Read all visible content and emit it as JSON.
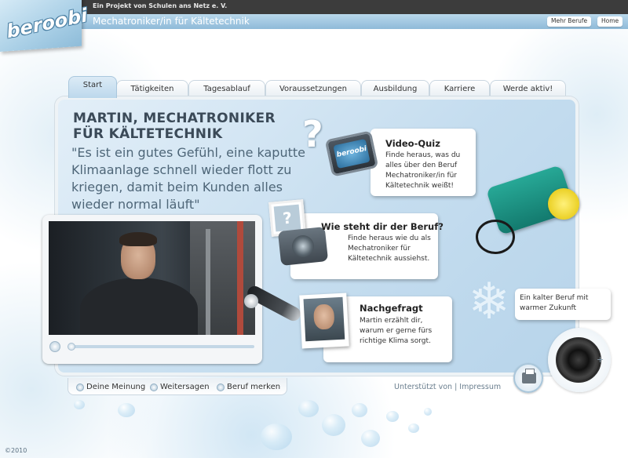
{
  "header": {
    "logo_text": "beroobi",
    "project_text": "Ein Projekt von Schulen ans Netz e. V.",
    "page_title": "Mechatroniker/in für Kältetechnik",
    "buttons": {
      "more_jobs": "Mehr Berufe",
      "home": "Home"
    }
  },
  "tabs": [
    {
      "label": "Start",
      "active": true
    },
    {
      "label": "Tätigkeiten",
      "active": false
    },
    {
      "label": "Tagesablauf",
      "active": false
    },
    {
      "label": "Voraussetzungen",
      "active": false
    },
    {
      "label": "Ausbildung",
      "active": false
    },
    {
      "label": "Karriere",
      "active": false
    },
    {
      "label": "Werde aktiv!",
      "active": false
    }
  ],
  "main": {
    "heading_line1": "MARTIN, MECHATRONIKER",
    "heading_line2": "FÜR KÄLTETECHNIK",
    "quote": "\"Es ist ein gutes Gefühl, eine kaputte Klimaanlage schnell wieder flott zu kriegen, damit beim Kunden alles wieder normal läuft\""
  },
  "cards": {
    "video_quiz": {
      "title": "Video-Quiz",
      "text": "Finde heraus, was du alles über den Beruf Mechatroniker/in für Kältetechnik weißt!",
      "icon_text": "beroobi"
    },
    "wie_steht": {
      "title": "Wie steht dir der Beruf?",
      "text": "Finde heraus wie du als Mechatroniker für Kältetechnik aussiehst."
    },
    "nachgefragt": {
      "title": "Nachgefragt",
      "text": "Martin erzählt dir, warum er gerne fürs richtige Klima sorgt."
    },
    "cold": {
      "text": "Ein kalter Beruf mit warmer Zukunft"
    }
  },
  "bottom": {
    "links": [
      "Deine Meinung",
      "Weitersagen",
      "Beruf merken"
    ],
    "footer": "Unterstützt von | Impressum",
    "copyright": "©2010"
  },
  "icons": {
    "question": "?",
    "photo": "?",
    "snowflake": "❄",
    "volume_plus": "+"
  },
  "colors": {
    "accent": "#8fbad8",
    "topbar": "#3c3c3c",
    "panel": "#c5ddef"
  }
}
